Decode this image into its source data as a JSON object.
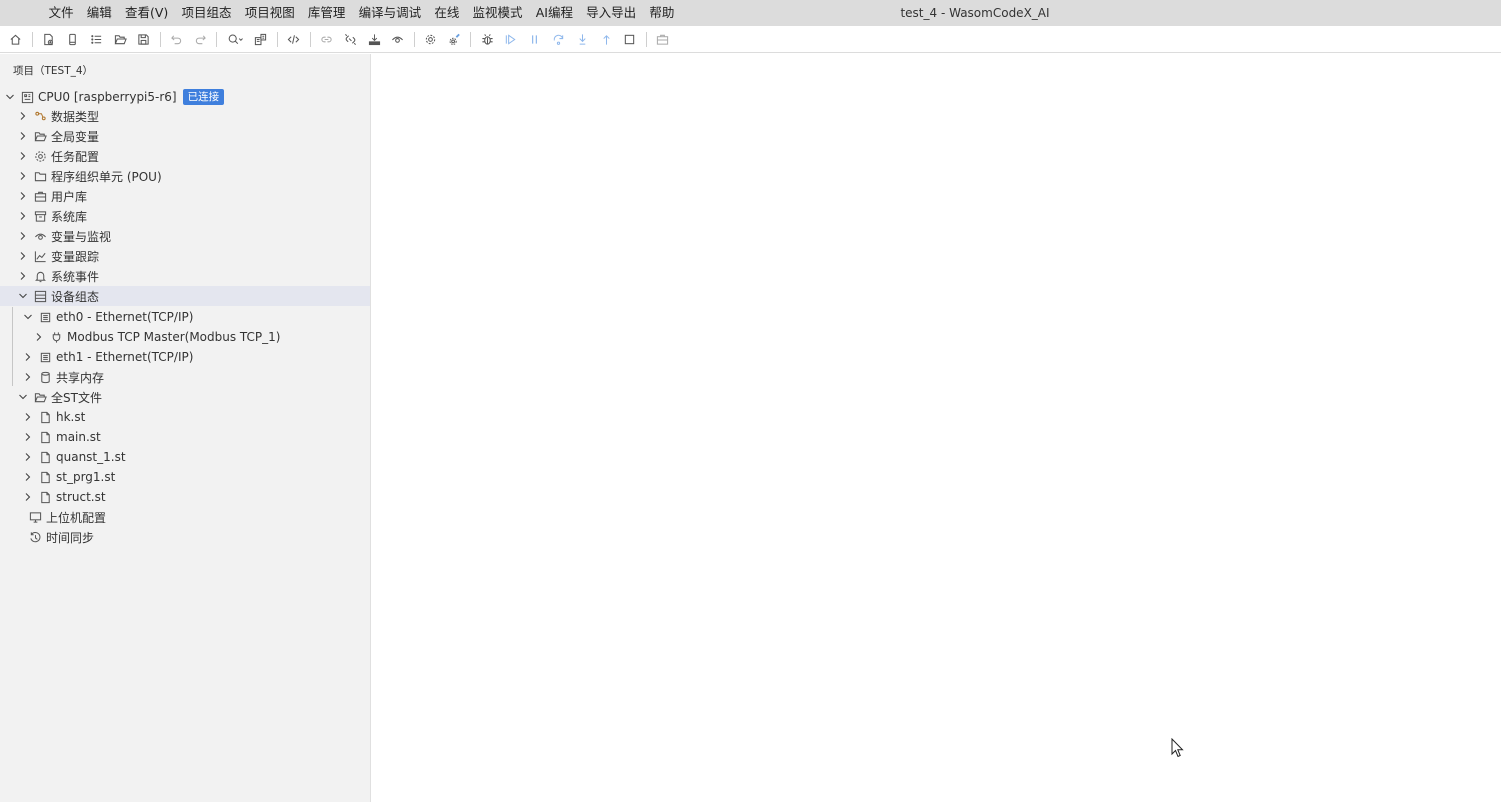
{
  "menubar": {
    "items": [
      "文件",
      "编辑",
      "查看(V)",
      "项目组态",
      "项目视图",
      "库管理",
      "编译与调试",
      "在线",
      "监视模式",
      "AI编程",
      "导入导出",
      "帮助"
    ],
    "window_title": "test_4 - WasomCodeX_AI"
  },
  "toolbar": {
    "buttons": [
      "home-icon",
      "new-file-icon",
      "device-icon",
      "list-icon",
      "open-folder-icon",
      "save-icon",
      "undo-icon",
      "redo-icon",
      "search-icon",
      "replace-icon",
      "code-icon",
      "link-icon",
      "unlink-icon",
      "download-icon",
      "monitor-eye-icon",
      "settings-icon",
      "settings-edit-icon",
      "debug-icon",
      "run-icon",
      "pause-icon",
      "step-over-icon",
      "step-into-icon",
      "step-out-icon",
      "stop-icon",
      "toolbox-icon"
    ]
  },
  "sidebar": {
    "title": "项目（TEST_4）",
    "cpu": {
      "label": "CPU0 [raspberrypi5-r6]",
      "status": "已连接"
    },
    "tree": {
      "data_types": "数据类型",
      "global_vars": "全局变量",
      "task_config": "任务配置",
      "pou": "程序组织单元 (POU)",
      "user_lib": "用户库",
      "system_lib": "系统库",
      "var_monitor": "变量与监视",
      "var_trace": "变量跟踪",
      "system_events": "系统事件",
      "device_config": "设备组态",
      "eth0": "eth0 - Ethernet(TCP/IP)",
      "modbus": "Modbus TCP Master(Modbus TCP_1)",
      "eth1": "eth1 - Ethernet(TCP/IP)",
      "shared_mem": "共享内存",
      "all_st": "全ST文件",
      "st_files": [
        "hk.st",
        "main.st",
        "quanst_1.st",
        "st_prg1.st",
        "struct.st"
      ],
      "host_config": "上位机配置",
      "time_sync": "时间同步"
    }
  },
  "colors": {
    "badge": "#3f7fdd",
    "menubar": "#dcdcdc",
    "sidebar": "#f2f2f2",
    "selected": "#e4e6ef"
  }
}
